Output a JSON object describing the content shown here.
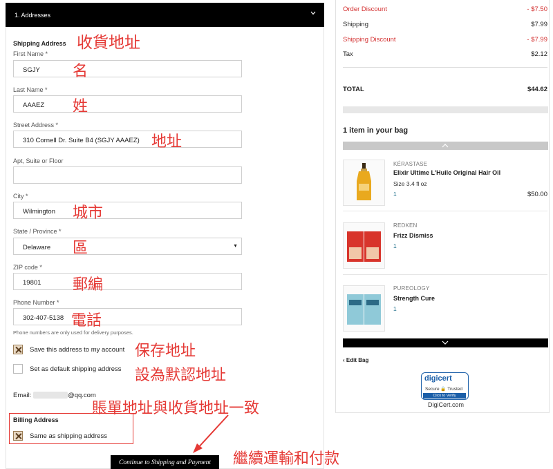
{
  "section": {
    "title": "1. Addresses"
  },
  "shipping": {
    "heading": "Shipping Address",
    "first_name": {
      "label": "First Name *",
      "value": "SGJY"
    },
    "last_name": {
      "label": "Last Name *",
      "value": "AAAEZ"
    },
    "street": {
      "label": "Street Address *",
      "value": "310 Cornell Dr. Suite B4 (SGJY AAAEZ)"
    },
    "apt": {
      "label": "Apt, Suite or Floor",
      "value": ""
    },
    "city": {
      "label": "City *",
      "value": "Wilmington"
    },
    "state": {
      "label": "State / Province *",
      "value": "Delaware"
    },
    "zip": {
      "label": "ZIP code *",
      "value": "19801"
    },
    "phone": {
      "label": "Phone Number *",
      "value": "302-407-5138"
    },
    "phone_hint": "Phone numbers are only used for delivery purposes.",
    "save_account_label": "Save this address to my account",
    "default_label": "Set as default shipping address",
    "email_prefix": "Email:",
    "email_suffix": "@qq.com"
  },
  "billing": {
    "heading": "Billing Address",
    "same_label": "Same as shipping address"
  },
  "continue_label": "Continue to Shipping and Payment",
  "annotations": {
    "shipping_address": "收貨地址",
    "first_name": "名",
    "last_name": "姓",
    "street": "地址",
    "city": "城市",
    "state": "區",
    "zip": "郵編",
    "phone": "電話",
    "save_address": "保存地址",
    "set_default": "設為默認地址",
    "billing_same": "賬單地址與收貨地址一致",
    "continue": "繼續運輸和付款"
  },
  "summary": {
    "order_discount_label": "Order Discount",
    "order_discount_value": "- $7.50",
    "shipping_label": "Shipping",
    "shipping_value": "$7.99",
    "shipping_discount_label": "Shipping Discount",
    "shipping_discount_value": "- $7.99",
    "tax_label": "Tax",
    "tax_value": "$2.12",
    "total_label": "TOTAL",
    "total_value": "$44.62"
  },
  "bag": {
    "title": "1 item in your bag",
    "items": [
      {
        "brand": "KÉRASTASE",
        "name": "Elixir Ultime L'Huile Original Hair Oil",
        "size": "Size 3.4 fl oz",
        "qty": "1",
        "price": "$50.00"
      },
      {
        "brand": "REDKEN",
        "name": "Frizz Dismiss",
        "qty": "1"
      },
      {
        "brand": "PUREOLOGY",
        "name": "Strength Cure",
        "qty": "1"
      }
    ],
    "edit_label": "Edit Bag"
  },
  "digicert": {
    "logo_text": "digicert",
    "secure_text": "Secure",
    "trusted_text": "Trusted",
    "verify_text": "Click to Verify",
    "name": "DigiCert.com"
  },
  "colors": {
    "annotation": "#e53935",
    "discount": "#d32f2f",
    "header_bg": "#000000"
  }
}
